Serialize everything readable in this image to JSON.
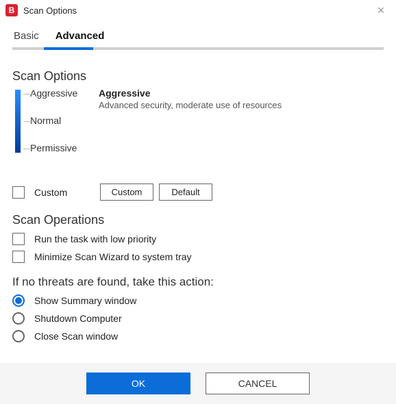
{
  "window": {
    "title": "Scan Options",
    "logo_letter": "B"
  },
  "tabs": {
    "basic": "Basic",
    "advanced": "Advanced",
    "active": "advanced"
  },
  "scan_options": {
    "title": "Scan Options",
    "levels": {
      "aggressive": "Aggressive",
      "normal": "Normal",
      "permissive": "Permissive"
    },
    "selected": {
      "name": "Aggressive",
      "desc": "Advanced security, moderate use of resources"
    },
    "custom_label": "Custom",
    "custom_btn": "Custom",
    "default_btn": "Default"
  },
  "scan_operations": {
    "title": "Scan Operations",
    "low_priority": "Run the task with low priority",
    "minimize_tray": "Minimize Scan Wizard to system tray"
  },
  "no_threats": {
    "title": "If no threats are found, take this action:",
    "show_summary": "Show Summary window",
    "shutdown": "Shutdown Computer",
    "close_window": "Close Scan window",
    "selected": "show_summary"
  },
  "footer": {
    "ok": "OK",
    "cancel": "CANCEL"
  }
}
